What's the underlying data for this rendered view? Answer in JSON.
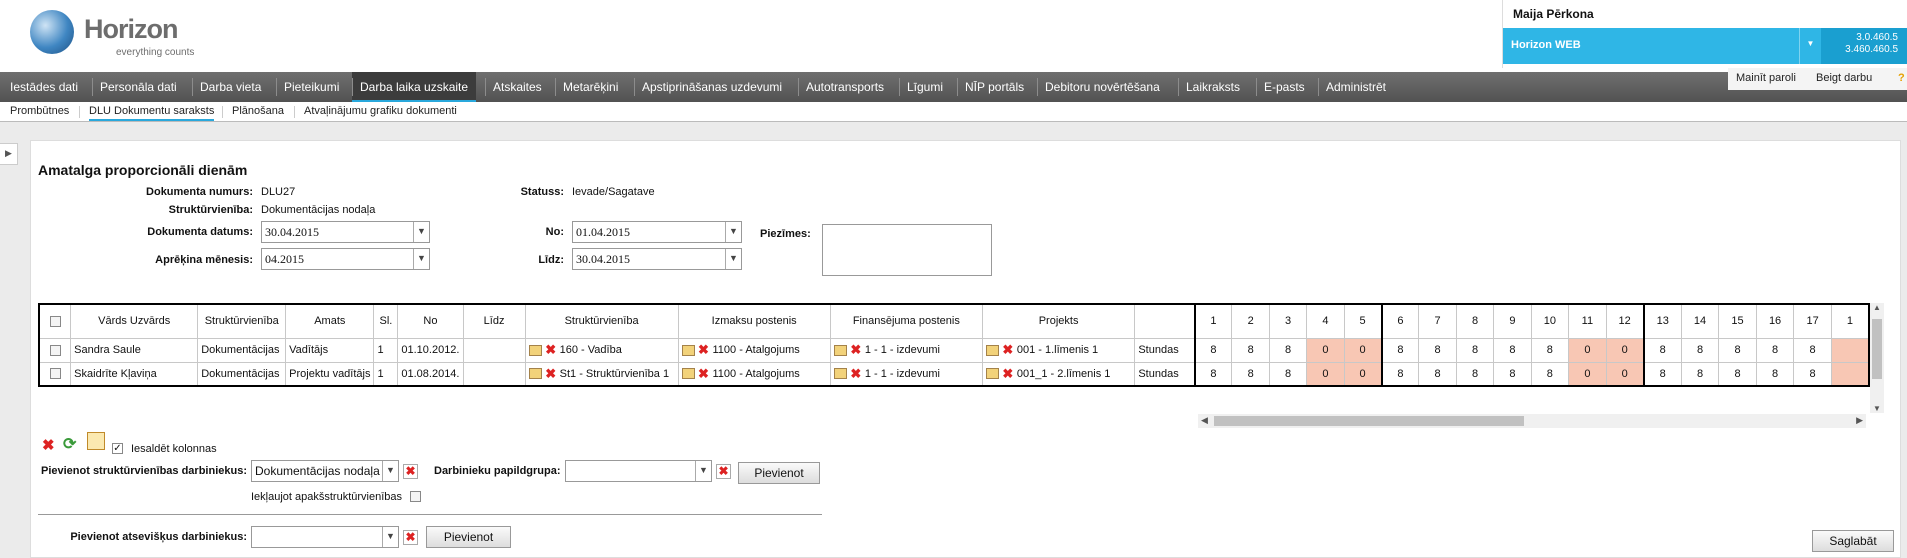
{
  "logo": {
    "title": "Horizon",
    "subtitle": "everything counts"
  },
  "user": {
    "name": "Maija Pērkona",
    "app": "Horizon WEB",
    "version1": "3.0.460.5",
    "version2": "3.460.460.5"
  },
  "menu": [
    "Iestādes dati",
    "Personāla dati",
    "Darba vieta",
    "Pieteikumi",
    "Darba laika uzskaite",
    "Atskaites",
    "Metarēķini",
    "Apstiprināšanas uzdevumi",
    "Autotransports",
    "Līgumi",
    "NĪP portāls",
    "Debitoru novērtēšana",
    "Laikraksts",
    "E-pasts",
    "Administrēt"
  ],
  "right_buttons": {
    "change_password": "Mainīt paroli",
    "end_work": "Beigt darbu"
  },
  "submenu": [
    "Prombūtnes",
    "DLU Dokumentu saraksts",
    "Plānošana",
    "Atvaļinājumu grafiku dokumenti"
  ],
  "form": {
    "title": "Amatalga proporcionāli dienām",
    "doc_num_label": "Dokumenta numurs:",
    "doc_num": "DLU27",
    "unit_label": "Struktūrvienība:",
    "unit": "Dokumentācijas nodaļa",
    "doc_date_label": "Dokumenta datums:",
    "doc_date": "30.04.2015",
    "month_label": "Aprēķina mēnesis:",
    "month": "04.2015",
    "status_label": "Statuss:",
    "status": "Ievade/Sagatave",
    "from_label": "No:",
    "from": "01.04.2015",
    "to_label": "Līdz:",
    "to": "30.04.2015",
    "notes_label": "Piezīmes:"
  },
  "table": {
    "headers": {
      "name": "Vārds Uzvārds",
      "unit": "Struktūrvienība",
      "position": "Amats",
      "sl": "Sl.",
      "from": "No",
      "to": "Līdz",
      "struct": "Struktūrvienība",
      "cost": "Izmaksu postenis",
      "finance": "Finansējuma postenis",
      "project": "Projekts"
    },
    "days": [
      "1",
      "2",
      "3",
      "4",
      "5",
      "6",
      "7",
      "8",
      "9",
      "10",
      "11",
      "12",
      "13",
      "14",
      "15",
      "16",
      "17",
      "1"
    ],
    "rows": [
      {
        "name": "Sandra Saule",
        "unit": "Dokumentācijas",
        "position": "Vadītājs",
        "sl": "1",
        "from": "01.10.2012.",
        "to": "",
        "struct": "160 - Vadība",
        "cost": "1100 - Atalgojums",
        "finance": "1 - 1 - izdevumi",
        "project": "001 - 1.līmenis 1",
        "type": "Stundas",
        "values": [
          "8",
          "8",
          "8",
          "0",
          "0",
          "8",
          "8",
          "8",
          "8",
          "8",
          "0",
          "0",
          "8",
          "8",
          "8",
          "8",
          "8",
          ""
        ]
      },
      {
        "name": "Skaidrīte Kļaviņa",
        "unit": "Dokumentācijas",
        "position": "Projektu vadītājs",
        "sl": "1",
        "from": "01.08.2014.",
        "to": "",
        "struct": "St1 - Struktūrvienība 1",
        "cost": "1100 - Atalgojums",
        "finance": "1 - 1 - izdevumi",
        "project": "001_1 - 2.līmenis 1",
        "type": "Stundas",
        "values": [
          "8",
          "8",
          "8",
          "0",
          "0",
          "8",
          "8",
          "8",
          "8",
          "8",
          "0",
          "0",
          "8",
          "8",
          "8",
          "8",
          "8",
          ""
        ]
      }
    ]
  },
  "bottom": {
    "freeze_label": "Iesaldēt kolonnas",
    "add_unit_label": "Pievienot struktūrvienības darbiniekus:",
    "add_unit_value": "Dokumentācijas nodaļa",
    "include_sub_label": "Iekļaujot apakšstruktūrvienības",
    "extra_group_label": "Darbinieku papildgrupa:",
    "add_button": "Pievienot",
    "add_individual_label": "Pievienot atsevišķus darbiniekus:",
    "save_button": "Saglabāt"
  }
}
